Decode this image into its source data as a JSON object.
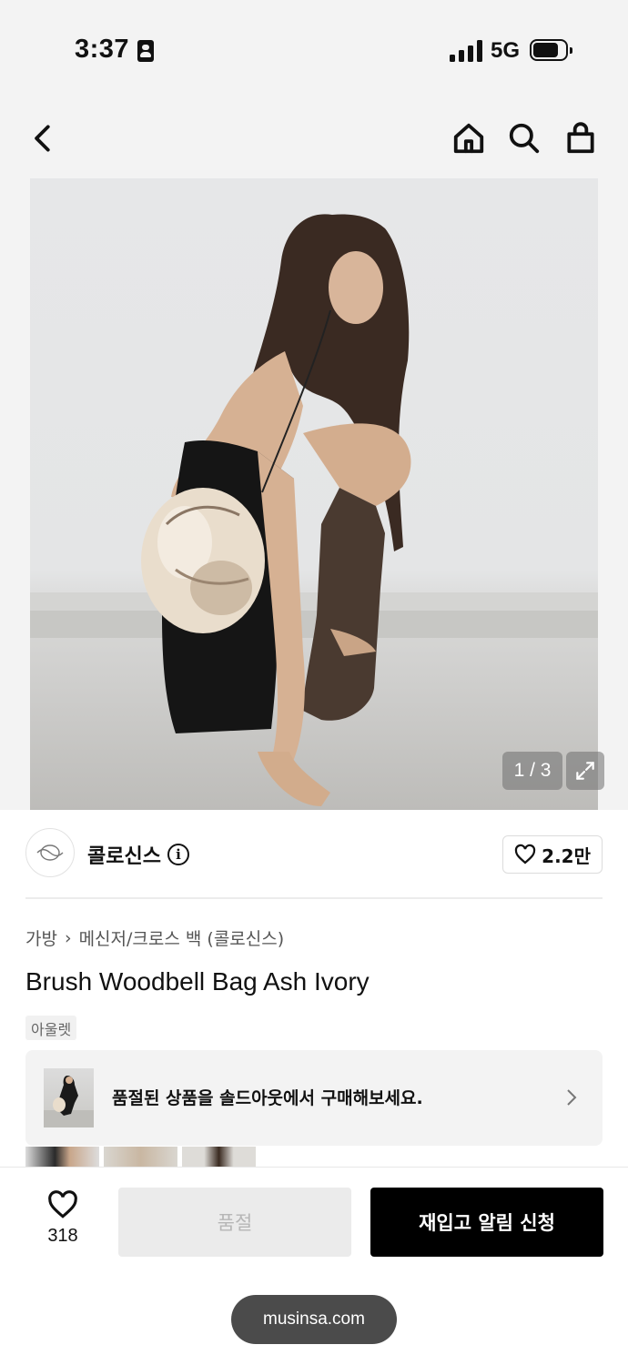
{
  "status_bar": {
    "time": "3:37",
    "network": "5G",
    "battery_level": 0.8,
    "id_icon": "person-card-icon",
    "signal_icon": "cellular-signal-icon",
    "battery_icon": "battery-icon"
  },
  "nav": {
    "back_icon": "chevron-left-icon",
    "home_icon": "home-icon",
    "search_icon": "search-icon",
    "bag_icon": "shopping-bag-icon"
  },
  "hero": {
    "page_counter": "1 / 3",
    "expand_icon": "expand-arrows-icon"
  },
  "brand": {
    "name": "콜로신스",
    "likes": "2.2만",
    "logo_icon": "brand-logo-icon",
    "info_icon": "info-icon",
    "heart_icon": "heart-outline-icon"
  },
  "product": {
    "breadcrumb": [
      "가방",
      "메신저/크로스 백 (콜로신스)"
    ],
    "breadcrumb_separator": "›",
    "title": "Brush Woodbell Bag Ash Ivory",
    "badge": "아울렛"
  },
  "soldout_banner": {
    "text": "품절된 상품을 솔드아웃에서 구매해보세요.",
    "chevron_icon": "chevron-right-icon"
  },
  "bottom_bar": {
    "wish_count": "318",
    "soldout_label": "품절",
    "restock_label": "재입고 알림 신청",
    "heart_icon": "heart-outline-icon"
  },
  "browser": {
    "url": "musinsa.com"
  },
  "colors": {
    "accent": "#000000",
    "background": "#f3f3f3",
    "disabled": "#ebebeb"
  }
}
